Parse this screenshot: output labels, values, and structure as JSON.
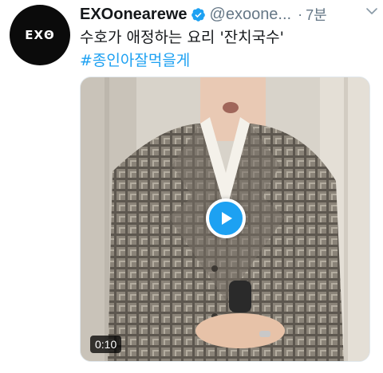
{
  "tweet": {
    "avatar_text": "ΕΧΘ",
    "display_name": "EXOonearewe",
    "handle": "@exoone...",
    "separator": "·",
    "time": "7분",
    "text": "수호가 애정하는 요리 '잔치국수'",
    "hashtag": "#종인아잘먹을게",
    "media": {
      "duration": "0:10"
    }
  },
  "colors": {
    "accent": "#1da1f2",
    "muted": "#657786",
    "text": "#14171a"
  }
}
